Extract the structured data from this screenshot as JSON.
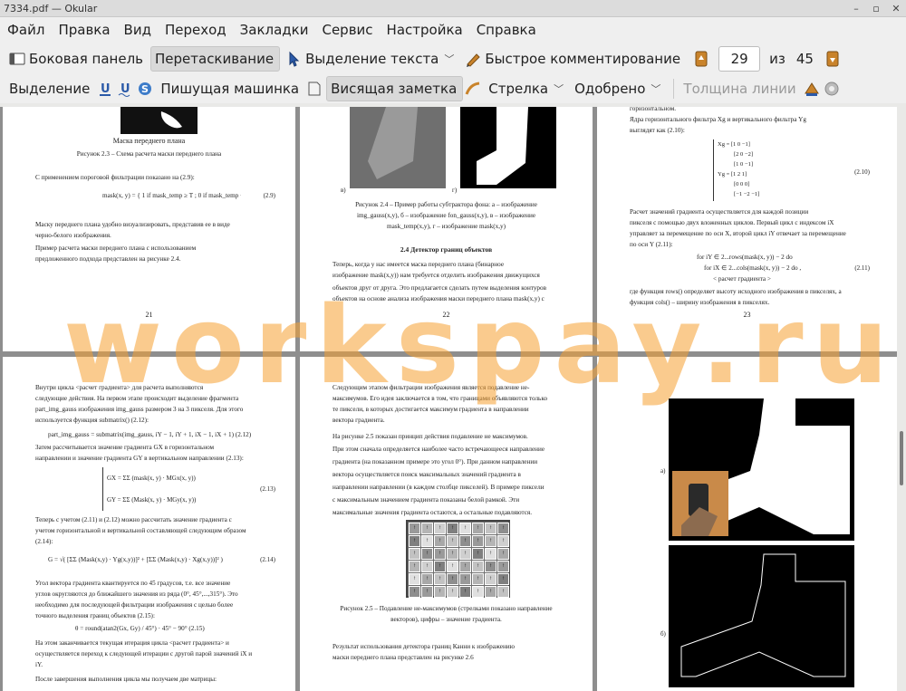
{
  "window": {
    "title": "7334.pdf  — Okular",
    "controls": [
      "–",
      "▫",
      "✕"
    ]
  },
  "menu": [
    "Файл",
    "Правка",
    "Вид",
    "Переход",
    "Закладки",
    "Сервис",
    "Настройка",
    "Справка"
  ],
  "toolbar1": {
    "sidebar": "Боковая панель",
    "browse": "Перетаскивание",
    "text_select": "Выделение текста",
    "quick_annot": "Быстрое комментирование",
    "page_current": "29",
    "page_of": "из",
    "page_total": "45"
  },
  "toolbar2": {
    "highlight": "Выделение",
    "typewriter": "Пишущая машинка",
    "sticky": "Висящая заметка",
    "arrow": "Стрелка",
    "stamp": "Одобрено",
    "line_width": "Толщина линии"
  },
  "watermark": "workspay.ru",
  "pages": {
    "p21": {
      "figure_label": "Маска переднего плана",
      "caption": "Рисунок 2.3 – Схема расчета маски переднего плана",
      "lines": [
        "С применением пороговой фильтрации показано на (2.9):",
        "Маску переднего плана удобно визуализировать, представив ее в виде",
        "черно-белого изображения.",
        "Пример расчета маски переднего плана с использованием",
        "предложенного подхода представлен на рисунке 2.4."
      ],
      "formula": "mask(x, y) = { 1 if mask_temp ≥ T ; 0 if mask_temp < T",
      "eq": "(2.9)",
      "num": "21"
    },
    "p22": {
      "label_a": "в)",
      "label_b": "г)",
      "caption": [
        "Рисунок 2.4 – Пример работы субтрактора фона: а – изображение",
        "img_gauss(x,y), б – изображение fon_gauss(x,y), в – изображение",
        "mask_temp(x,y), г – изображение mask(x,y)"
      ],
      "heading": "2.4 Детектор границ объектов",
      "lines": [
        "Теперь, когда у нас имеется маска переднего плана (бинарное",
        "изображение mask(x,y))  нам требуется отделить изображения движущихся",
        "объектов друг от друга. Это предлагается сделать путем выделения контуров",
        "объектов на основе анализа изображения маски переднего плана mask(x,y) с"
      ],
      "num": "22"
    },
    "p23": {
      "lines_top": [
        "горизонтальном.",
        "Ядра горизонтального фильтра Xg и вертикального фильтра Yg",
        "выглядят как (2.10):"
      ],
      "eq1": "(2.10)",
      "lines_mid": [
        "Расчет значений градиента осуществляется для каждой позиции",
        "пикселя с помощью двух вложенных циклов. Первый цикл с индексом iX",
        "управляет за перемещение по оси X, второй цикл iY отвечает за перемещение",
        "по оси Y (2.11):"
      ],
      "code": [
        "for iY ∈ 2...rows(mask(x, y)) − 2 do",
        "for iX ∈ 2...cols(mask(x, y)) − 2 do ,",
        "< расчет градиента >"
      ],
      "eq2": "(2.11)",
      "lines_bottom": [
        "где функция rows() определяет высоту исходного изображения в пикселях, а",
        "функция cols() – ширину изображения в пикселях."
      ],
      "num": "23"
    },
    "p24": {
      "lines": [
        "Внутри цикла <расчет градиента> для расчета выполняются",
        "следующие действия. На первом этапе происходит выделение фрагмента",
        "part_img_gauss изображения img_gauss размером 3 на 3 пикселя. Для этого",
        "используется функция submatrix() (2.12):",
        "part_img_gauss = submatrix(img_gauss, iY − 1, iY + 1, iX − 1, iX + 1)   (2.12)",
        "Затем рассчитывается значение градиента GX в горизонтальном",
        "направлении и значение градиента GY в вертикальном направлении (2.13):"
      ],
      "gx": "GX = ΣΣ (mask(x, y) · MGx(x, y))",
      "gy": "GY = ΣΣ (Mask(x, y) · MGy(x, y))",
      "eq13": "(2.13)",
      "lines2": [
        "Теперь с учетом (2.11) и (2.12) можно рассчитать значение градиента с",
        "учетом горизонтальной и вертикальной составляющей следующим образом",
        "(2.14):"
      ],
      "g": "G = √( [ΣΣ (Mask(x,y) · Yg(x,y))]² + [ΣΣ (Mask(x,y) · Xg(x,y))]² )",
      "eq14": "(2.14)",
      "lines3": [
        "Угол вектора градиента квантируется по 45 градусов, т.е. все значение",
        "углов округляются до ближайшего значения из ряда (0°, 45°,...,315°). Это",
        "необходимо для последующей фильтрации изображения с целью более",
        "точного выделения границ объектов (2.15):",
        "θ = round(atan2(Gx, Gy) / 45°) · 45° − 90°   (2.15)",
        "На этом заканчивается текущая итерация цикла <расчет градиента> и",
        "осуществляется переход к следующей итерации с другой парой значений iX и",
        "iY.",
        "После завершения выполнения цикла мы получаем две матрицы:"
      ]
    },
    "p25": {
      "lines": [
        "Следующим этапом фильтрации изображения является подавление не-",
        "максимумов. Его идея заключается в том, что границами объявляются только",
        "те пиксели, в которых достигается максимум градиента в направлении",
        "вектора градиента.",
        "На рисунке 2.5 показан принцип действия подавление не максимумов.",
        "При этом сначала определяется наиболее часто встречающееся направление",
        "градиента (на показанном примере это угол 0°). При данном направлении",
        "вектора осуществляется поиск максимальных значений градиента в",
        "направлении направлении (в каждом столбце пикселей). В примере пиксели",
        "с максимальным значением градиента показаны белой рамкой. Эти",
        "максимальные значения градиента остаются, а остальные подавляются."
      ],
      "caption": [
        "Рисунок 2.5 – Подавление не-максимумов (стрелками показано направление",
        "векторов), цифры – значение градиента."
      ],
      "lines2": [
        "Результат использования детектора границ Канни к изображению",
        "маски переднего плана представлен на рисунке 2.6"
      ]
    },
    "p26": {
      "label_a": "а)",
      "label_b": "б)"
    }
  }
}
